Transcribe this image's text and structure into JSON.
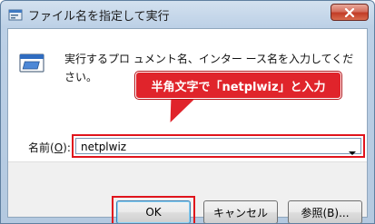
{
  "window": {
    "title": "ファイル名を指定して実行"
  },
  "dialog": {
    "description": "実行するプロ                                             ュメント名、インター                       ース名を入力してください。",
    "callout_text": "半角文字で「netplwiz」と入力",
    "name_label_prefix": "名前(",
    "name_label_key": "O",
    "name_label_suffix": "):",
    "input_value": "netplwiz"
  },
  "buttons": {
    "ok": "OK",
    "cancel": "キャンセル",
    "browse": "参照(B)..."
  },
  "colors": {
    "highlight_red": "#e0141c",
    "callout_red": "#e0242b",
    "close_button_red": "#c23c26"
  },
  "icons": {
    "title_icon": "run-dialog-icon",
    "run_icon": "run-program-icon",
    "close_icon": "close-icon",
    "dropdown_icon": "chevron-down-icon"
  }
}
